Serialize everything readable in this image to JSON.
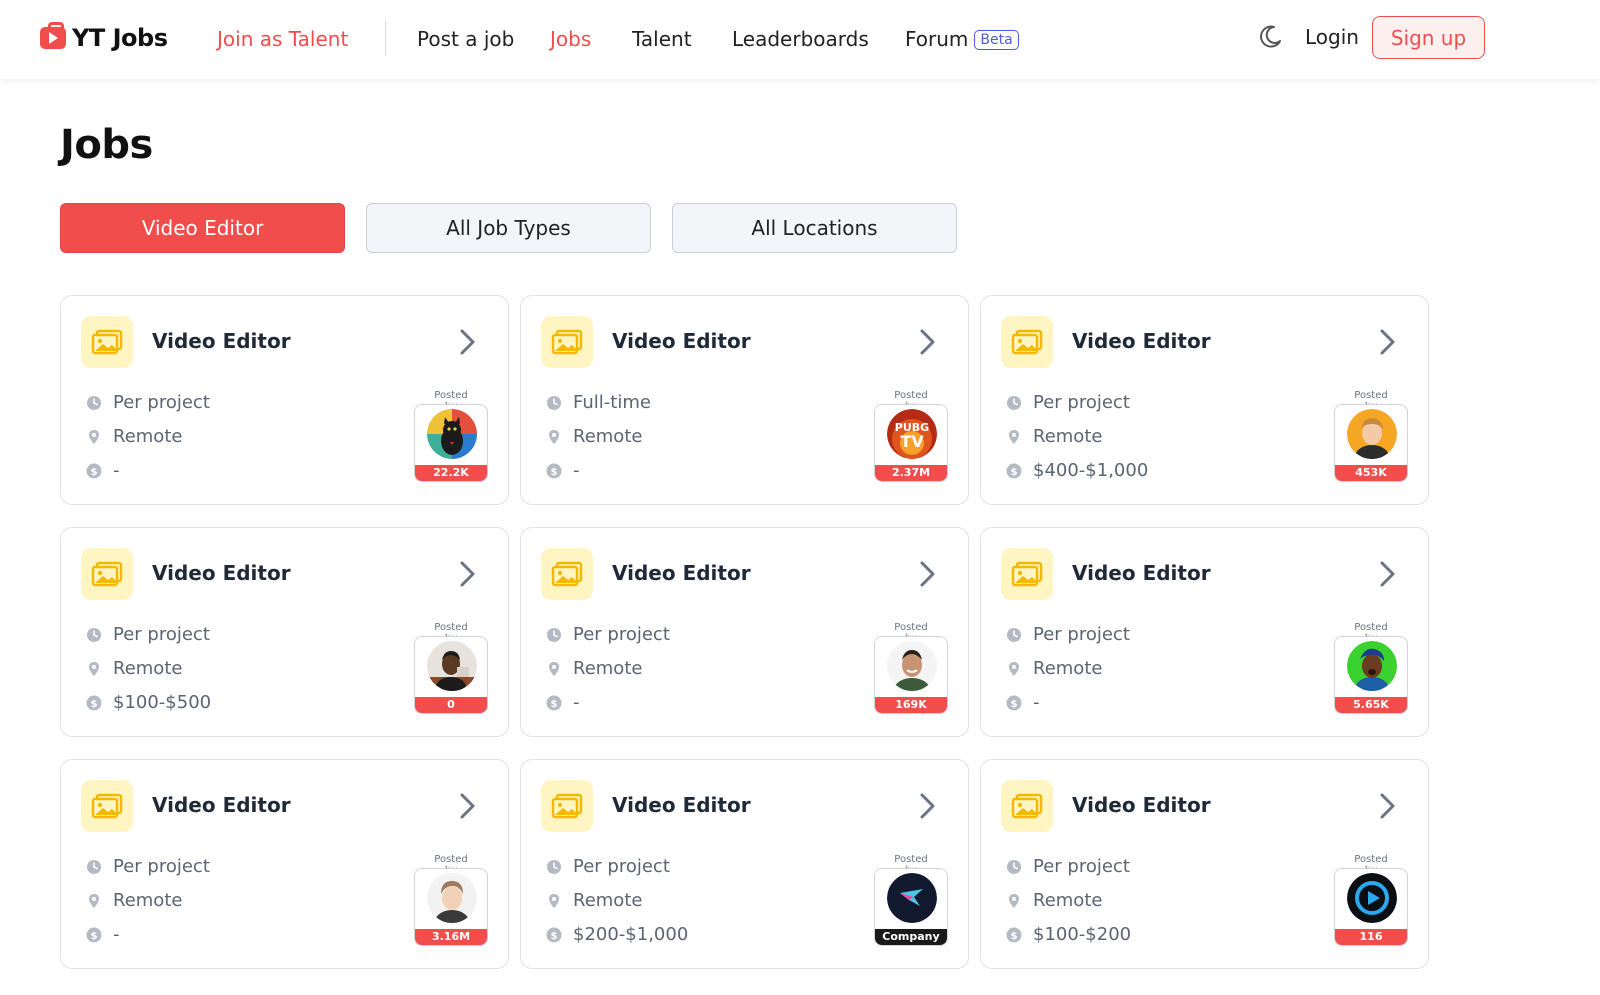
{
  "nav": {
    "logo": "YT Jobs",
    "join_talent": "Join as Talent",
    "post_job": "Post a job",
    "jobs": "Jobs",
    "talent": "Talent",
    "leaderboards": "Leaderboards",
    "forum": "Forum",
    "forum_badge": "Beta",
    "login": "Login",
    "signup": "Sign up",
    "accent_color": "#f24d4d"
  },
  "page": {
    "title": "Jobs"
  },
  "filters": {
    "role": "Video Editor",
    "job_type": "All Job Types",
    "location": "All Locations"
  },
  "posted_by_label": "Posted by",
  "jobs": [
    {
      "title": "Video Editor",
      "type": "Per project",
      "location": "Remote",
      "pay": "-",
      "subscribers": "22.2K",
      "avatar": "cat"
    },
    {
      "title": "Video Editor",
      "type": "Full-time",
      "location": "Remote",
      "pay": "-",
      "subscribers": "2.37M",
      "avatar": "pubg-tv"
    },
    {
      "title": "Video Editor",
      "type": "Per project",
      "location": "Remote",
      "pay": "$400-$1,000",
      "subscribers": "453K",
      "avatar": "person-blond"
    },
    {
      "title": "Video Editor",
      "type": "Per project",
      "location": "Remote",
      "pay": "$100-$500",
      "subscribers": "0",
      "avatar": "person-dark"
    },
    {
      "title": "Video Editor",
      "type": "Per project",
      "location": "Remote",
      "pay": "-",
      "subscribers": "169K",
      "avatar": "person-smile"
    },
    {
      "title": "Video Editor",
      "type": "Per project",
      "location": "Remote",
      "pay": "-",
      "subscribers": "5.65K",
      "avatar": "person-green"
    },
    {
      "title": "Video Editor",
      "type": "Per project",
      "location": "Remote",
      "pay": "-",
      "subscribers": "3.16M",
      "avatar": "person-young"
    },
    {
      "title": "Video Editor",
      "type": "Per project",
      "location": "Remote",
      "pay": "$200-$1,000",
      "subscribers": "Company",
      "avatar": "bird-logo"
    },
    {
      "title": "Video Editor",
      "type": "Per project",
      "location": "Remote",
      "pay": "$100-$200",
      "subscribers": "116",
      "avatar": "circle-arrow-logo"
    }
  ]
}
